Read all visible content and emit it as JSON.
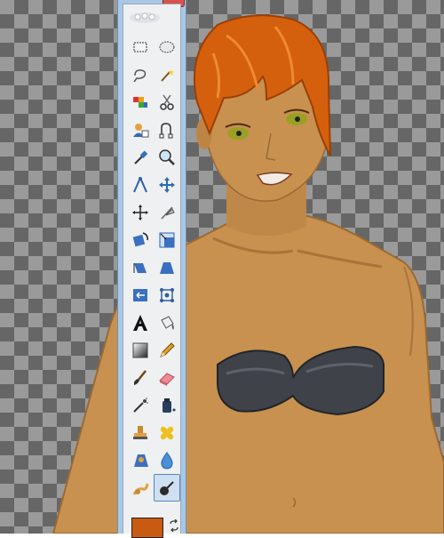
{
  "toolbox": {
    "active_tool": "ink",
    "tools": [
      {
        "name": "rect-select-icon"
      },
      {
        "name": "ellipse-select-icon"
      },
      {
        "name": "free-select-icon"
      },
      {
        "name": "fuzzy-select-icon"
      },
      {
        "name": "select-by-color-icon"
      },
      {
        "name": "scissors-select-icon"
      },
      {
        "name": "foreground-select-icon"
      },
      {
        "name": "paths-icon"
      },
      {
        "name": "color-picker-icon"
      },
      {
        "name": "zoom-icon"
      },
      {
        "name": "measure-icon"
      },
      {
        "name": "move-icon"
      },
      {
        "name": "align-icon"
      },
      {
        "name": "crop-icon"
      },
      {
        "name": "rotate-icon"
      },
      {
        "name": "scale-icon"
      },
      {
        "name": "shear-icon"
      },
      {
        "name": "perspective-icon"
      },
      {
        "name": "flip-icon"
      },
      {
        "name": "cage-transform-icon"
      },
      {
        "name": "text-icon"
      },
      {
        "name": "bucket-fill-icon"
      },
      {
        "name": "blend-icon"
      },
      {
        "name": "pencil-icon"
      },
      {
        "name": "paintbrush-icon"
      },
      {
        "name": "eraser-icon"
      },
      {
        "name": "airbrush-icon"
      },
      {
        "name": "ink-icon"
      },
      {
        "name": "clone-icon"
      },
      {
        "name": "heal-icon"
      },
      {
        "name": "perspective-clone-icon"
      },
      {
        "name": "blur-sharpen-icon"
      },
      {
        "name": "smudge-icon"
      },
      {
        "name": "dodge-burn-icon"
      }
    ],
    "foreground_color": "#c85a12"
  },
  "colors": {
    "skin": "#c8914f",
    "hair": "#d4600e",
    "top": "#3f4349",
    "eyes": "#9aa024"
  }
}
